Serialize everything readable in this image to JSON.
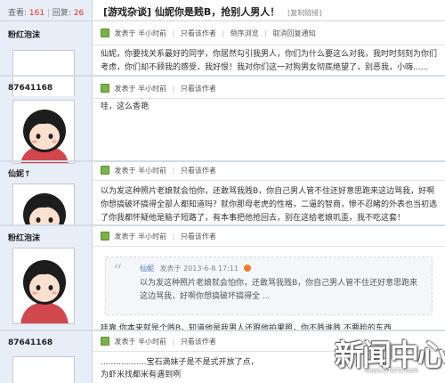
{
  "stats": {
    "views_label": "查看:",
    "views": "161",
    "replies_label": "回复:",
    "replies": "26"
  },
  "thread": {
    "title": "[游戏杂谈] 仙妮你是贱B，抢别人男人！",
    "copy_link": "[复制链接]"
  },
  "meta": {
    "posted": "发表于 半小时前",
    "only_author": "只看该作者",
    "reverse": "倒序浏览",
    "cancel_notify": "取消回复通知"
  },
  "posts": [
    {
      "username": "粉红泡沫",
      "content": "仙妮，你要找关系最好的同学，你居然勾引我男人，你们为什么要这么对我，我时时刻刻为你们考虑，你们却不顾我的感受，我好恨！我对你们这一对狗男女彻底绝望了，别恶我，小嗨......"
    },
    {
      "username": "87641168",
      "content": "哇，这么香艳"
    },
    {
      "username": "仙妮↑",
      "content": "以为发这种照片老娘就会怕你，还敢骂我贱B，你自己男人管不住还好意思跑来这边骂我，好啊你想搞破坏搞得全部人都知道吗？就你那母老虎的性格，二逼的智商，惨不忍睹的外表也当初选了你我都怀疑他是脑子短路了，有本事把他抢回去，别在这给老娘叽歪，我不吃这套！"
    },
    {
      "username": "粉红泡沫",
      "quote_author": "仙妮",
      "quote_time": "发表于 2013-6-8 17:11",
      "quote_body": "以为发这种照片老娘就会怕你，还敢骂我贱B，你自己男人管不住还好意思跑来这边骂我，好啊你想搞破坏搞得全 ...",
      "content": "哇靠 你本来就是个贱B，知道他是我男人还跟他拍果照，你不贱谁贱 不要脸的东西"
    },
    {
      "username": "87641168",
      "content_line1": "..................宝石滴妹子是不是式开放了点，",
      "content_line2": "为虾米找都米有遇到咧"
    }
  ],
  "watermark": {
    "text": "新闻中心",
    "url": "news.07073.com"
  }
}
